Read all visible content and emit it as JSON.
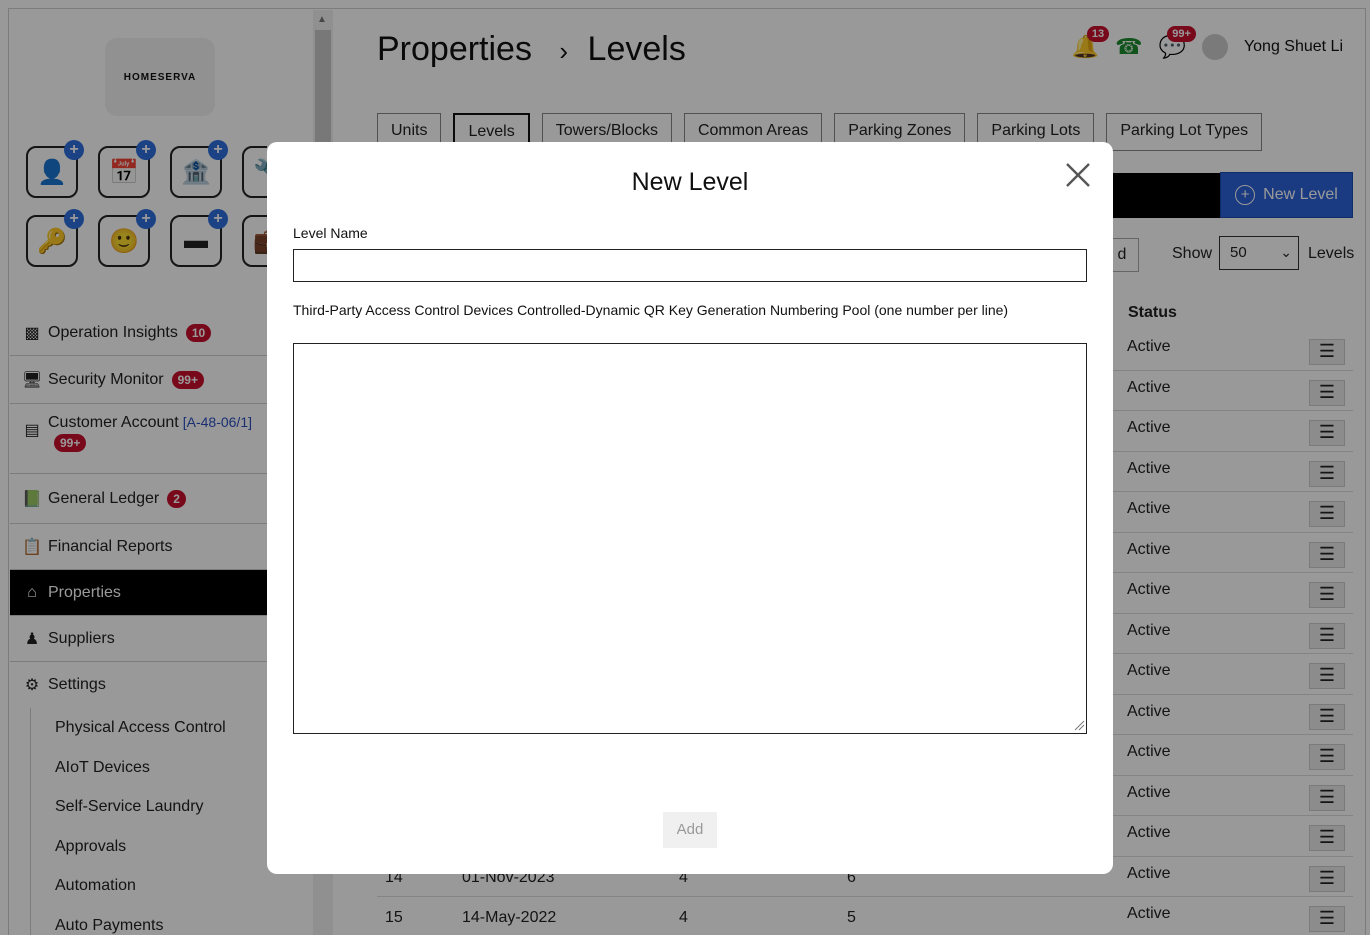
{
  "app": {
    "logo_text": "HOMESERVA"
  },
  "header": {
    "title": "Properties",
    "breadcrumb_sep": "›",
    "subtitle": "Levels",
    "notification_count": "13",
    "messages_count": "99+",
    "user_name": "Yong Shuet Li"
  },
  "quick_actions": [
    {
      "icon": "id-card-icon"
    },
    {
      "icon": "calendar-icon"
    },
    {
      "icon": "bank-icon"
    },
    {
      "icon": "tools-icon"
    },
    {
      "icon": "key-card-icon"
    },
    {
      "icon": "person-icon"
    },
    {
      "icon": "license-plate-icon"
    },
    {
      "icon": "badge-icon"
    }
  ],
  "sidebar": {
    "items": [
      {
        "label": "Operation Insights",
        "badge": "10",
        "icon": "bar-chart-icon"
      },
      {
        "label": "Security Monitor",
        "badge": "99+",
        "icon": "monitor-icon"
      },
      {
        "label": "Customer Account",
        "code": "[A-48-06/1]",
        "badge": "99+",
        "icon": "id-card-icon"
      },
      {
        "label": "General Ledger",
        "badge": "2",
        "icon": "ledger-icon"
      },
      {
        "label": "Financial Reports",
        "icon": "report-icon"
      },
      {
        "label": "Properties",
        "icon": "home-icon"
      },
      {
        "label": "Suppliers",
        "icon": "supplier-icon"
      },
      {
        "label": "Settings",
        "icon": "gear-icon"
      }
    ],
    "sub_items": [
      "Physical Access Control",
      "AIoT Devices",
      "Self-Service Laundry",
      "Approvals",
      "Automation",
      "Auto Payments"
    ]
  },
  "tabs": [
    "Units",
    "Levels",
    "Towers/Blocks",
    "Common Areas",
    "Parking Zones",
    "Parking Lots",
    "Parking Lot Types"
  ],
  "toolbar": {
    "new_level_label": "New Level",
    "filter_partial": "d",
    "show_label": "Show",
    "show_value": "50",
    "levels_label": "Levels"
  },
  "table": {
    "status_header": "Status",
    "rows": [
      {
        "status": "Active"
      },
      {
        "status": "Active"
      },
      {
        "status": "Active"
      },
      {
        "status": "Active"
      },
      {
        "status": "Active"
      },
      {
        "status": "Active"
      },
      {
        "status": "Active"
      },
      {
        "status": "Active"
      },
      {
        "status": "Active"
      },
      {
        "status": "Active"
      },
      {
        "status": "Active"
      },
      {
        "status": "Active"
      },
      {
        "status": "Active"
      },
      {
        "id": "14",
        "date": "01-Nov-2023",
        "c3": "4",
        "c4": "6",
        "status": "Active"
      },
      {
        "id": "15",
        "date": "14-May-2022",
        "c3": "4",
        "c4": "5",
        "status": "Active"
      }
    ]
  },
  "modal": {
    "title": "New Level",
    "level_name_label": "Level Name",
    "level_name_value": "",
    "pool_label": "Third-Party Access Control Devices Controlled-Dynamic QR Key Generation Numbering Pool (one number per line)",
    "pool_value": "",
    "add_label": "Add"
  },
  "colors": {
    "accent": "#2c63d8",
    "badge": "#c8102e",
    "active_nav": "#000000"
  }
}
